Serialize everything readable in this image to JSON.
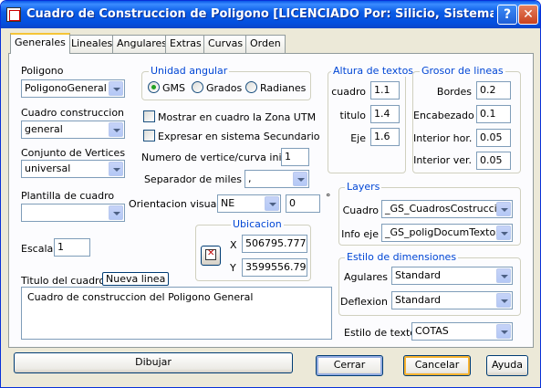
{
  "window": {
    "title": "Cuadro de Construccion de Poligono  [LICENCIADO Por: Silicio, Sistemas e Ingenie...",
    "help_glyph": "?",
    "close_glyph": "✕"
  },
  "tabs": [
    {
      "label": "Generales",
      "active": true
    },
    {
      "label": "Lineales"
    },
    {
      "label": "Angulares"
    },
    {
      "label": "Extras"
    },
    {
      "label": "Curvas"
    },
    {
      "label": "Orden"
    }
  ],
  "left": {
    "poligono_label": "Poligono",
    "poligono_value": "PoligonoGeneral",
    "cuadro_label": "Cuadro construccion",
    "cuadro_value": "general",
    "vertices_label": "Conjunto de Vertices",
    "vertices_value": "universal",
    "plantilla_label": "Plantilla de cuadro",
    "plantilla_value": "",
    "escala_label": "Escala",
    "escala_value": "1",
    "titulo_label": "Titulo del cuadro",
    "nueva_linea": "Nueva linea",
    "titulo_value": "Cuadro de construccion del Poligono General"
  },
  "unidad": {
    "title": "Unidad angular",
    "options": [
      "GMS",
      "Grados",
      "Radianes"
    ],
    "selected": "GMS"
  },
  "checks": {
    "utm": "Mostrar en cuadro la Zona UTM",
    "secundario": "Expresar en sistema Secundario"
  },
  "numeracion": {
    "label": "Numero de vertice/curva inicial",
    "value": "1"
  },
  "separador": {
    "label": "Separador de miles",
    "value": ","
  },
  "orientacion": {
    "label": "Orientacion visual",
    "value": "NE",
    "angle": "0",
    "degree": "°"
  },
  "ubicacion": {
    "title": "Ubicacion",
    "x_label": "X",
    "x_value": "506795.7776",
    "y_label": "Y",
    "y_value": "3599556.795"
  },
  "altura": {
    "title": "Altura de textos",
    "rows": [
      {
        "label": "cuadro",
        "value": "1.1"
      },
      {
        "label": "titulo",
        "value": "1.4"
      },
      {
        "label": "Eje",
        "value": "1.6"
      }
    ]
  },
  "grosor": {
    "title": "Grosor de lineas",
    "rows": [
      {
        "label": "Bordes",
        "value": "0.2"
      },
      {
        "label": "Encabezado",
        "value": "0.1"
      },
      {
        "label": "Interior hor.",
        "value": "0.05"
      },
      {
        "label": "Interior ver.",
        "value": "0.05"
      }
    ]
  },
  "layers": {
    "title": "Layers",
    "cuadro_label": "Cuadro",
    "cuadro_value": "_GS_CuadrosCostruccion",
    "info_label": "Info eje",
    "info_value": "_GS_poligDocumTextos"
  },
  "dimensiones": {
    "title": "Estilo de dimensiones",
    "aguleres_label": "Agulares",
    "aguleres_value": "Standard",
    "deflexion_label": "Deflexion",
    "deflexion_value": "Standard"
  },
  "estilo_texto": {
    "label": "Estilo de texto",
    "value": "COTAS"
  },
  "buttons": {
    "dibujar": "Dibujar",
    "cerrar": "Cerrar",
    "cancelar": "Cancelar",
    "ayuda": "Ayuda"
  }
}
